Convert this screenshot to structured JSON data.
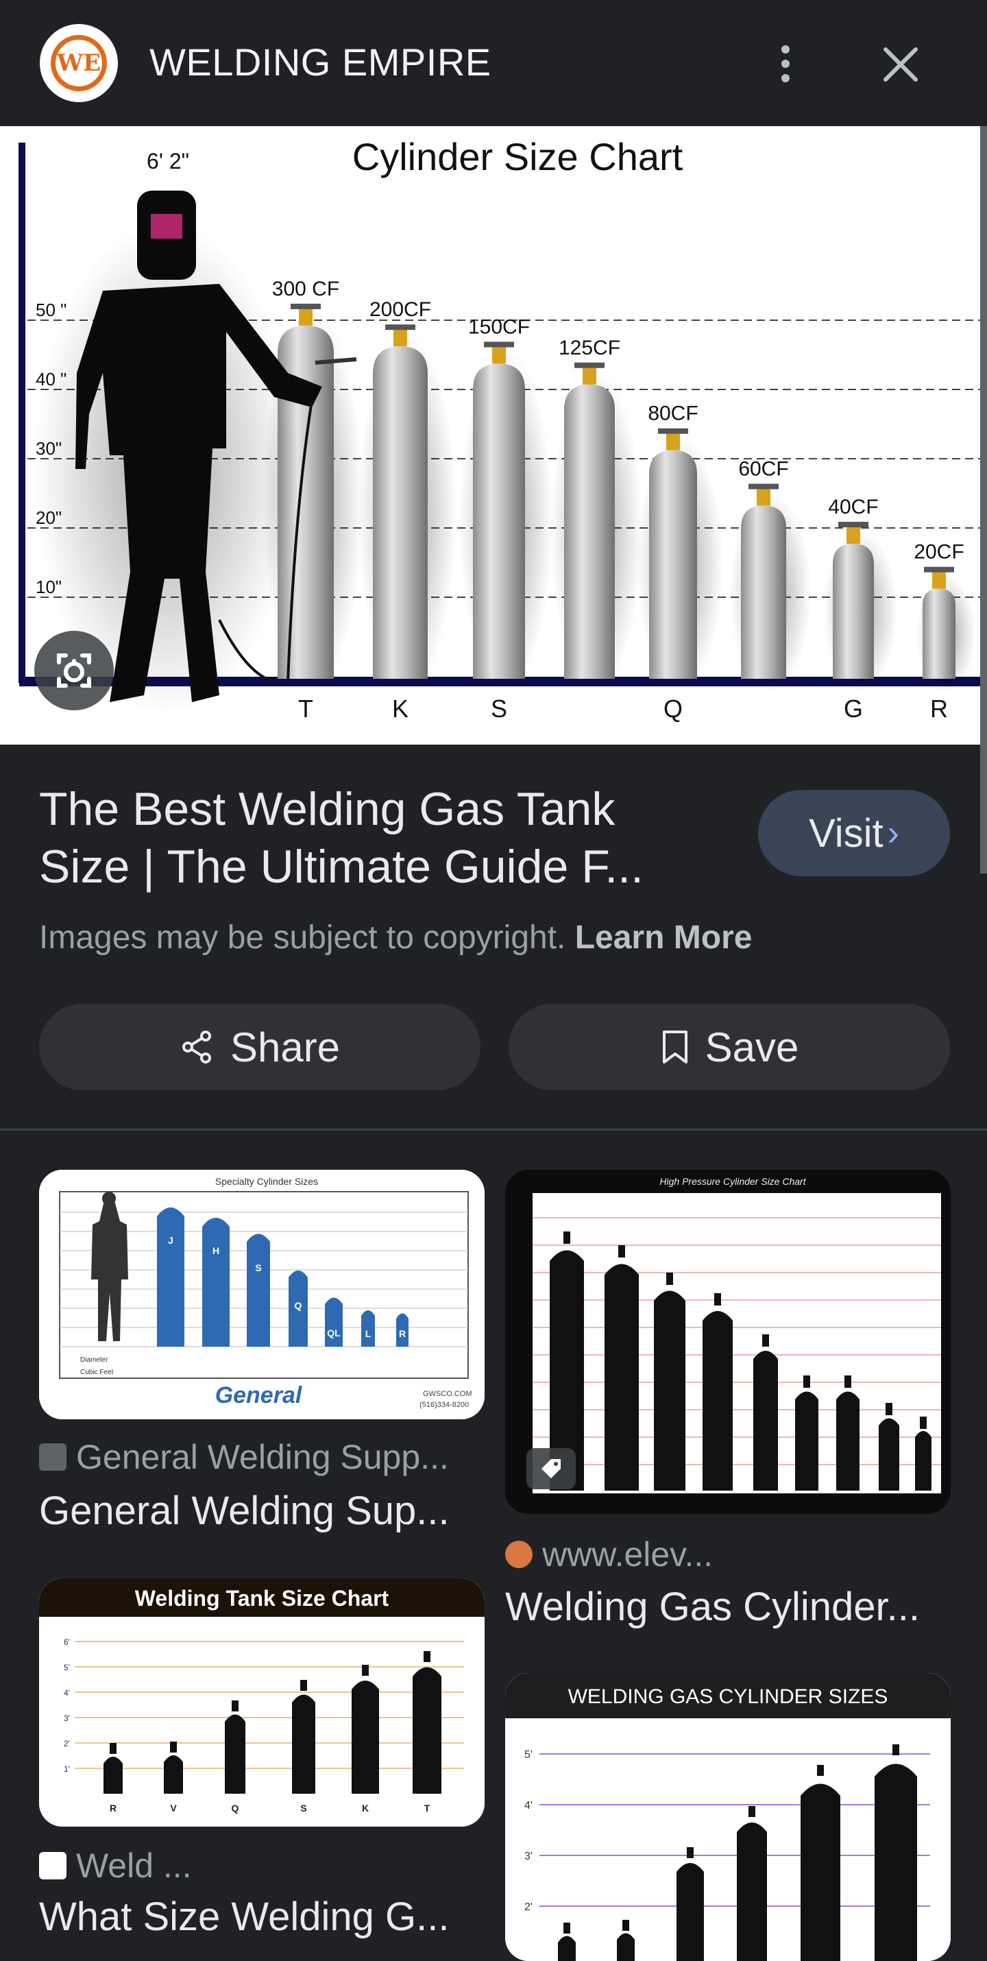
{
  "header": {
    "logo_text": "WE",
    "site_name": "WELDING EMPIRE",
    "more_icon": "more-vert-icon",
    "close_icon": "close-icon"
  },
  "hero_chart": {
    "title": "Cylinder Size Chart",
    "figure_height_label": "6' 2\"",
    "y_labels": [
      "50 \"",
      "40 \"",
      "30\"",
      "20\"",
      "10\""
    ],
    "cylinders": [
      {
        "capacity": "300 CF",
        "height_in": 51
      },
      {
        "capacity": "200CF",
        "height_in": 48
      },
      {
        "capacity": "150CF",
        "height_in": 45.5
      },
      {
        "capacity": "125CF",
        "height_in": 42.5
      },
      {
        "capacity": "80CF",
        "height_in": 33
      },
      {
        "capacity": "60CF",
        "height_in": 25
      },
      {
        "capacity": "40CF",
        "height_in": 19.5
      },
      {
        "capacity": "20CF",
        "height_in": 13
      }
    ],
    "x_letters": [
      {
        "letter": "T",
        "index": 0
      },
      {
        "letter": "K",
        "index": 1
      },
      {
        "letter": "S",
        "index": 2
      },
      {
        "letter": "Q",
        "index": 4
      },
      {
        "letter": "G",
        "index": 6
      },
      {
        "letter": "R",
        "index": 7
      }
    ]
  },
  "result": {
    "title_line1": "The Best Welding Gas Tank",
    "title_line2": "Size | The Ultimate Guide F...",
    "visit_label": "Visit",
    "copyright": "Images may be subject to copyright.",
    "learn_more": "Learn More",
    "share_label": "Share",
    "save_label": "Save"
  },
  "related": [
    {
      "thumb_title": "Specialty Cylinder Sizes",
      "brand": "General",
      "contact": "GWSCO.COM",
      "phone": "(516)334-8200",
      "cyl_letters": [
        "J",
        "H",
        "S",
        "Q",
        "QL",
        "L",
        "R"
      ],
      "source": "General Welding Supp...",
      "title": "General Welding Sup..."
    },
    {
      "thumb_title": "High Pressure Cylinder Size Chart",
      "source": "www.elev...",
      "title": "Welding Gas Cylinder..."
    },
    {
      "thumb_title": "Welding Tank Size Chart",
      "y_ticks": [
        "6'",
        "5'",
        "4'",
        "3'",
        "2'",
        "1'"
      ],
      "letters": [
        "R",
        "V",
        "Q",
        "S",
        "K",
        "T"
      ],
      "source": "Weld ...",
      "title": "What Size Welding G..."
    },
    {
      "thumb_title": "WELDING GAS CYLINDER SIZES",
      "y_ticks": [
        "5'",
        "4'",
        "3'",
        "2'"
      ]
    }
  ],
  "colors": {
    "background": "#202124",
    "accent_orange": "#e06a1b",
    "visit_button": "#394457",
    "link_blue": "#8ab4f8"
  }
}
